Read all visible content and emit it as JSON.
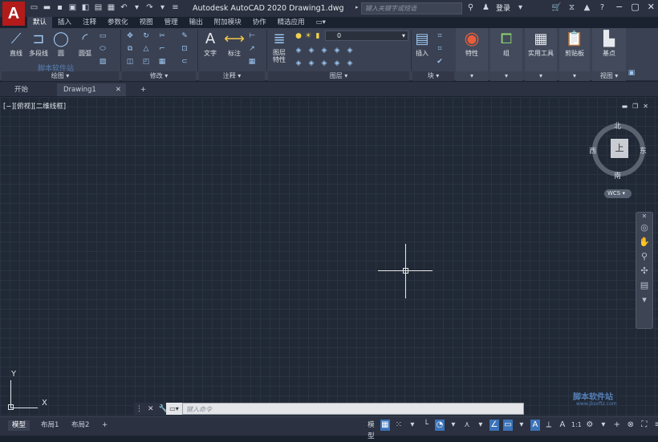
{
  "titlebar": {
    "logo": "A",
    "title": "Autodesk AutoCAD 2020    Drawing1.dwg",
    "search_placeholder": "键入关键字或短语",
    "login": "登录"
  },
  "ribbon_tabs": [
    "默认",
    "插入",
    "注释",
    "参数化",
    "视图",
    "管理",
    "输出",
    "附加模块",
    "协作",
    "精选应用"
  ],
  "draw": {
    "line": "直线",
    "polyline": "多段线",
    "circle": "圆",
    "arc": "圆弧",
    "title": "绘图"
  },
  "modify": {
    "title": "修改"
  },
  "annotation": {
    "text": "文字",
    "dimension": "标注",
    "title": "注释"
  },
  "layers": {
    "props": "图层\n特性",
    "current": "0",
    "title": "图层"
  },
  "block": {
    "insert": "插入",
    "title": "块"
  },
  "properties": {
    "label": "特性"
  },
  "group": {
    "label": "组"
  },
  "utilities": {
    "label": "实用工具"
  },
  "clipboard": {
    "label": "剪贴板"
  },
  "view": {
    "base": "基点",
    "title": "视图"
  },
  "file_tabs": {
    "start": "开始",
    "drawing": "Drawing1"
  },
  "viewport": {
    "label": "[−][俯视][二维线框]"
  },
  "viewcube": {
    "north": "北",
    "south": "南",
    "west": "西",
    "east": "东",
    "top": "上",
    "wcs": "WCS"
  },
  "ucs": {
    "x": "X",
    "y": "Y"
  },
  "command": {
    "placeholder": "键入命令"
  },
  "status": {
    "model": "模型",
    "layout1": "布局1",
    "layout2": "布局2",
    "model_label": "模型",
    "scale": "1:1"
  },
  "watermark": {
    "top": "脚本软件站",
    "bottom_cn": "脚本软件站",
    "bottom_en": "www.jbsoftz.com"
  },
  "colors": {
    "accent": "#3b73b9",
    "logo": "#b31b1b",
    "canvas": "#212936"
  }
}
